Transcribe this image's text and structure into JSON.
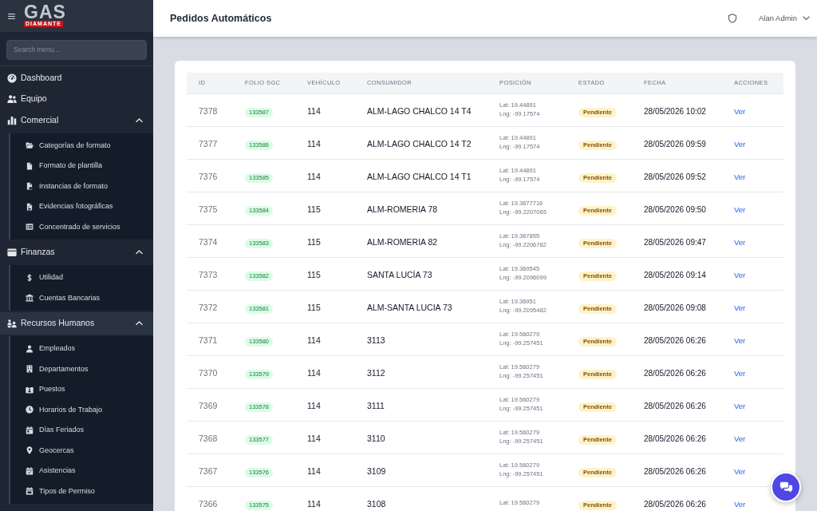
{
  "sidebar": {
    "logo": {
      "wordmark": "GAS",
      "band": "DIAMANTE"
    },
    "search": {
      "placeholder": "Search menu..."
    },
    "items": [
      {
        "label": "Dashboard",
        "selected": false
      },
      {
        "label": "Equipo",
        "selected": false
      },
      {
        "label": "Comercial",
        "selected": false,
        "expanded": true,
        "children": [
          {
            "label": "Categorías de formato",
            "selected": false
          },
          {
            "label": "Formato de plantilla",
            "selected": false
          },
          {
            "label": "Instancias de formato",
            "selected": false
          },
          {
            "label": "Evidencias fotográficas",
            "selected": false
          },
          {
            "label": "Concentrado de servicios",
            "selected": false
          }
        ]
      },
      {
        "label": "Finanzas",
        "selected": false,
        "expanded": true,
        "children": [
          {
            "label": "Utilidad",
            "selected": false
          },
          {
            "label": "Cuentas Bancarias",
            "selected": false
          }
        ]
      },
      {
        "label": "Recursos Humanos",
        "selected": true,
        "expanded": true,
        "children": [
          {
            "label": "Empleados",
            "selected": false
          },
          {
            "label": "Departamentos",
            "selected": false
          },
          {
            "label": "Puestos",
            "selected": false
          },
          {
            "label": "Horarios de Trabajo",
            "selected": false
          },
          {
            "label": "Días Feriados",
            "selected": false
          },
          {
            "label": "Geocercas",
            "selected": false
          },
          {
            "label": "Asistencias",
            "selected": false
          },
          {
            "label": "Tipos de Permiso",
            "selected": false
          }
        ]
      }
    ]
  },
  "header": {
    "title": "Pedidos Automáticos",
    "user": "Alan Admin"
  },
  "table": {
    "columns": [
      "ID",
      "FOLIO SGC",
      "VEHÍCULO",
      "CONSUMIDOR",
      "POSICIÓN",
      "ESTADO",
      "FECHA",
      "ACCIONES"
    ],
    "rows": [
      {
        "id": "7378",
        "folio": "133587",
        "vehicle": "114",
        "consumer": "ALM-LAGO CHALCO 14 T4",
        "position": {
          "lat": "Lat: 19.44891",
          "lng": "Lng: -99.17574"
        },
        "status": "Pendiente",
        "date": "28/05/2026 10:02",
        "action": "Ver"
      },
      {
        "id": "7377",
        "folio": "133586",
        "vehicle": "114",
        "consumer": "ALM-LAGO CHALCO 14 T2",
        "position": {
          "lat": "Lat: 19.44891",
          "lng": "Lng: -99.17574"
        },
        "status": "Pendiente",
        "date": "28/05/2026 09:59",
        "action": "Ver"
      },
      {
        "id": "7376",
        "folio": "133585",
        "vehicle": "114",
        "consumer": "ALM-LAGO CHALCO 14 T1",
        "position": {
          "lat": "Lat: 19.44891",
          "lng": "Lng: -99.17574"
        },
        "status": "Pendiente",
        "date": "28/05/2026 09:52",
        "action": "Ver"
      },
      {
        "id": "7375",
        "folio": "133584",
        "vehicle": "115",
        "consumer": "ALM-ROMERIA 78",
        "position": {
          "lat": "Lat: 19.3677716",
          "lng": "Lng: -99.2207065"
        },
        "status": "Pendiente",
        "date": "28/05/2026 09:50",
        "action": "Ver"
      },
      {
        "id": "7374",
        "folio": "133583",
        "vehicle": "115",
        "consumer": "ALM-ROMERIA 82",
        "position": {
          "lat": "Lat: 19.367855",
          "lng": "Lng: -99.2206782"
        },
        "status": "Pendiente",
        "date": "28/05/2026 09:47",
        "action": "Ver"
      },
      {
        "id": "7373",
        "folio": "133582",
        "vehicle": "115",
        "consumer": "SANTA LUCÍA 73",
        "position": {
          "lat": "Lat: 19.369545",
          "lng": "Lng: -99.2096099"
        },
        "status": "Pendiente",
        "date": "28/05/2026 09:14",
        "action": "Ver"
      },
      {
        "id": "7372",
        "folio": "133581",
        "vehicle": "115",
        "consumer": "ALM-SANTA LUCIA 73",
        "position": {
          "lat": "Lat: 19.36951",
          "lng": "Lng: -99.2095482"
        },
        "status": "Pendiente",
        "date": "28/05/2026 09:08",
        "action": "Ver"
      },
      {
        "id": "7371",
        "folio": "133580",
        "vehicle": "114",
        "consumer": "3113",
        "position": {
          "lat": "Lat: 19.560279",
          "lng": "Lng: -99.257451"
        },
        "status": "Pendiente",
        "date": "28/05/2026 06:26",
        "action": "Ver"
      },
      {
        "id": "7370",
        "folio": "133579",
        "vehicle": "114",
        "consumer": "3112",
        "position": {
          "lat": "Lat: 19.560279",
          "lng": "Lng: -99.257451"
        },
        "status": "Pendiente",
        "date": "28/05/2026 06:26",
        "action": "Ver"
      },
      {
        "id": "7369",
        "folio": "133578",
        "vehicle": "114",
        "consumer": "3111",
        "position": {
          "lat": "Lat: 19.560279",
          "lng": "Lng: -99.257451"
        },
        "status": "Pendiente",
        "date": "28/05/2026 06:26",
        "action": "Ver"
      },
      {
        "id": "7368",
        "folio": "133577",
        "vehicle": "114",
        "consumer": "3110",
        "position": {
          "lat": "Lat: 19.560279",
          "lng": "Lng: -99.257451"
        },
        "status": "Pendiente",
        "date": "28/05/2026 06:26",
        "action": "Ver"
      },
      {
        "id": "7367",
        "folio": "133576",
        "vehicle": "114",
        "consumer": "3109",
        "position": {
          "lat": "Lat: 19.560279",
          "lng": "Lng: -99.257451"
        },
        "status": "Pendiente",
        "date": "28/05/2026 06:26",
        "action": "Ver"
      },
      {
        "id": "7366",
        "folio": "133575",
        "vehicle": "114",
        "consumer": "3108",
        "position": {
          "lat": "Lat: 19.560279"
        },
        "status": "Pendiente",
        "date": "28/05/2026 06:26",
        "action": "Ver"
      }
    ]
  }
}
